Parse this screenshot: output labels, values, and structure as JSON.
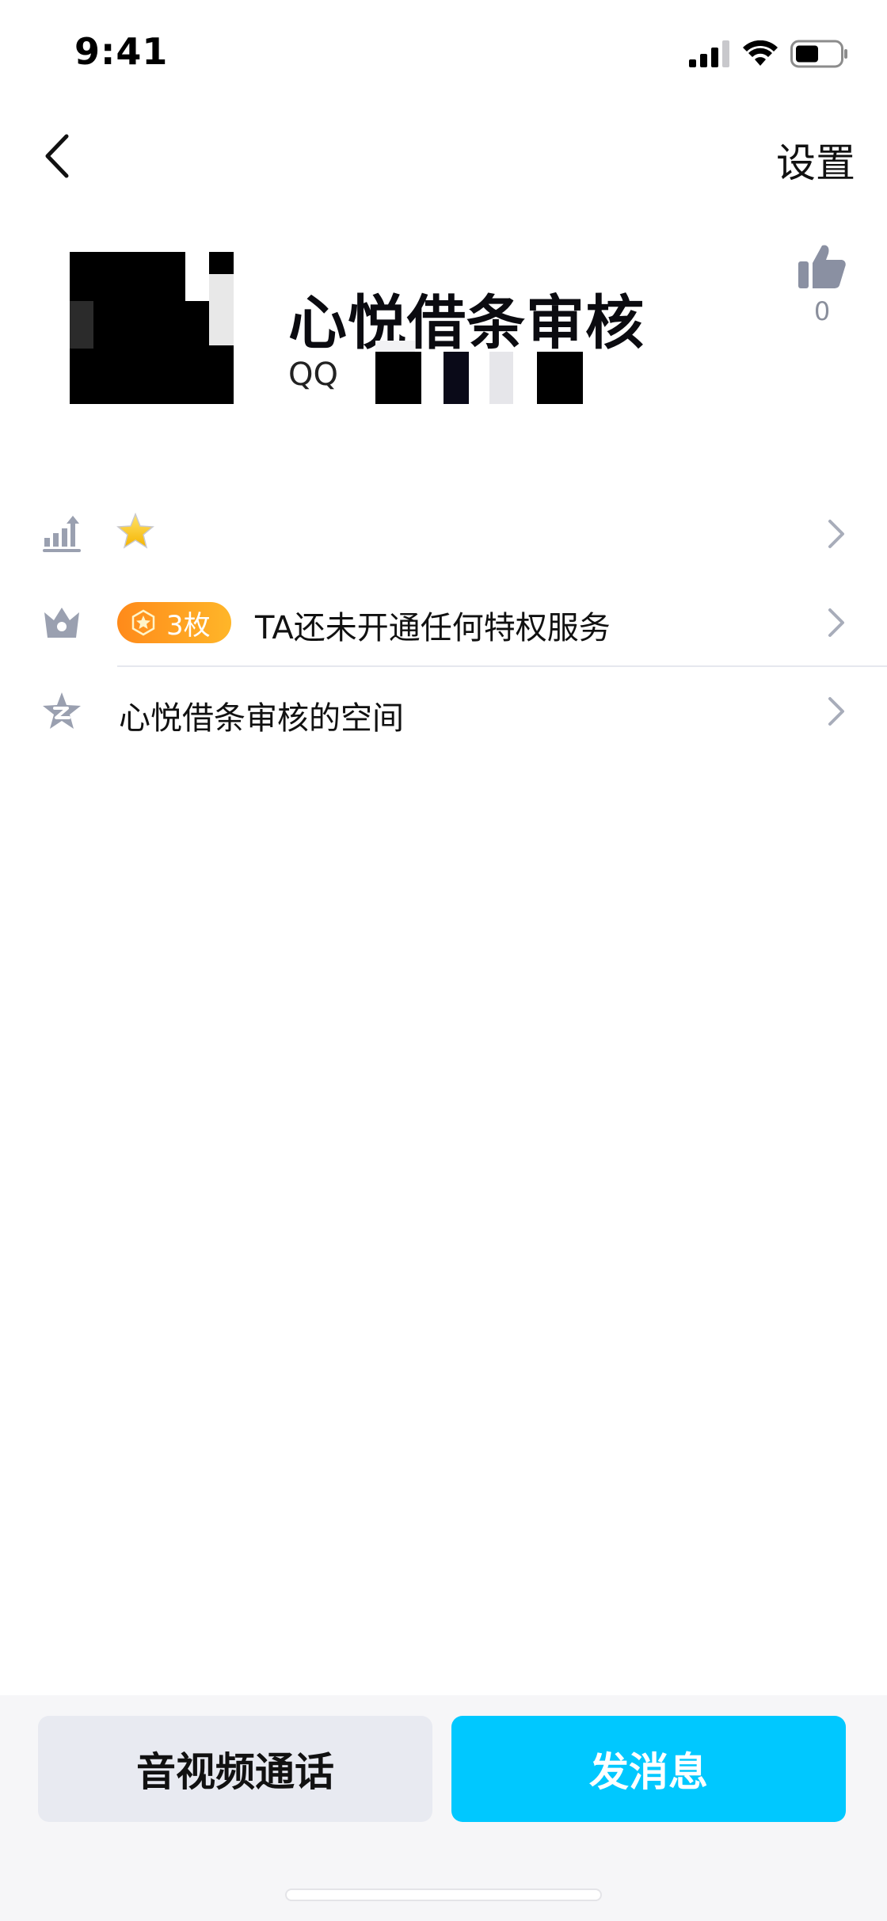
{
  "status_bar": {
    "time": "9:41"
  },
  "nav": {
    "settings_label": "设置"
  },
  "profile": {
    "display_name": "心悦借条审核",
    "qq_prefix": "QQ",
    "likes": "0"
  },
  "rows": {
    "level": {
      "icon": "level-up-icon",
      "badge_icon": "star-icon"
    },
    "privilege": {
      "icon": "crown-icon",
      "badge_label": "3枚",
      "text": "TA还未开通任何特权服务"
    },
    "space": {
      "icon": "qzone-star-icon",
      "text": "心悦借条审核的空间"
    }
  },
  "actions": {
    "call_label": "音视频通话",
    "message_label": "发消息"
  },
  "colors": {
    "accent": "#00c8ff",
    "badge_orange": "#ff8a1a",
    "icon_gray": "#9aa0b0"
  }
}
